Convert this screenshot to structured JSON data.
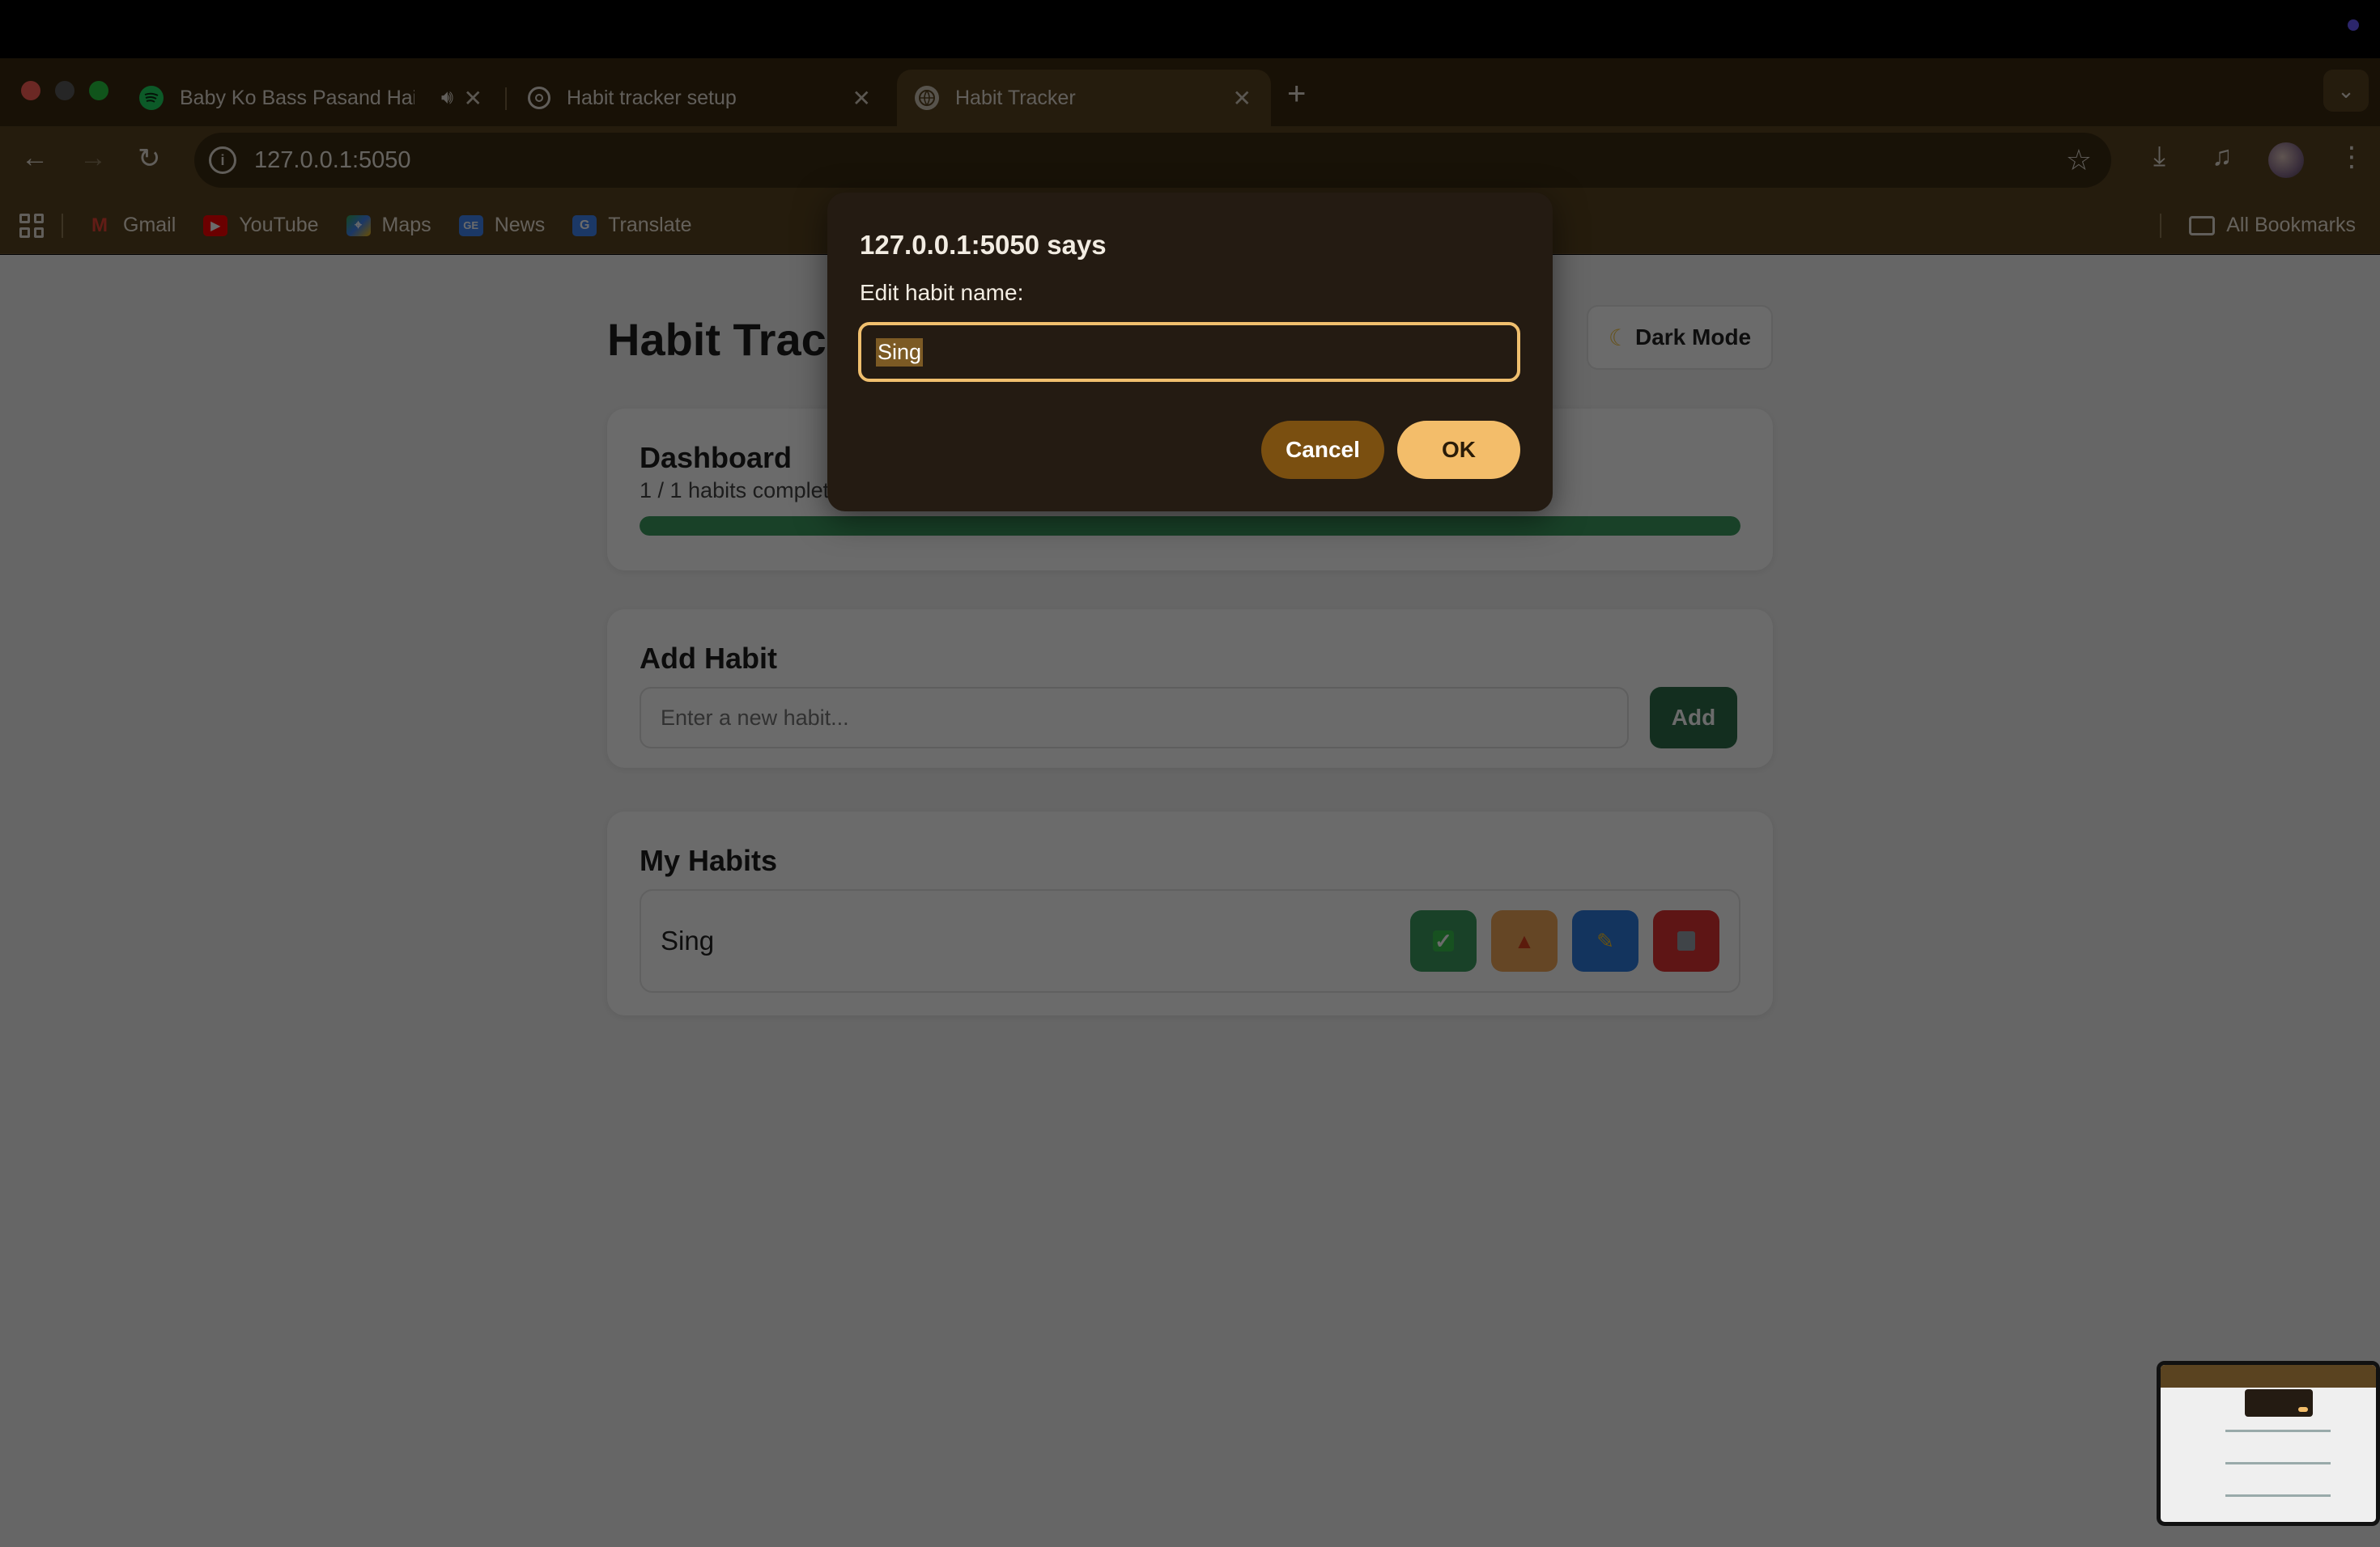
{
  "browser": {
    "tabs": [
      {
        "title": "Baby Ko Bass Pasand Hai",
        "favicon": "spotify-icon",
        "audio": true
      },
      {
        "title": "Habit tracker setup",
        "favicon": "openai-icon"
      },
      {
        "title": "Habit Tracker",
        "favicon": "globe-icon",
        "active": true
      }
    ],
    "url": "127.0.0.1:5050",
    "bookmarks": [
      {
        "label": "Gmail",
        "icon": "gmail-icon",
        "color": "#ea4335"
      },
      {
        "label": "YouTube",
        "icon": "youtube-icon",
        "color": "#ff0000"
      },
      {
        "label": "Maps",
        "icon": "maps-icon",
        "color": "#34a853"
      },
      {
        "label": "News",
        "icon": "news-icon",
        "color": "#4285f4"
      },
      {
        "label": "Translate",
        "icon": "translate-icon",
        "color": "#4285f4"
      }
    ],
    "all_bookmarks": "All Bookmarks"
  },
  "app": {
    "title": "Habit Tracker",
    "dark_mode_label": "Dark Mode",
    "dashboard": {
      "heading": "Dashboard",
      "progress_text": "1 / 1 habits completed",
      "progress_fraction": 1.0,
      "progress_color": "#3d9b5f"
    },
    "add_habit": {
      "heading": "Add Habit",
      "placeholder": "Enter a new habit...",
      "button_label": "Add"
    },
    "my_habits": {
      "heading": "My Habits",
      "items": [
        {
          "name": "Sing",
          "actions": [
            "check-icon",
            "fire-icon",
            "pencil-icon",
            "trash-icon"
          ]
        }
      ]
    }
  },
  "dialog": {
    "title": "127.0.0.1:5050 says",
    "message": "Edit habit name:",
    "value": "Sing",
    "cancel_label": "Cancel",
    "ok_label": "OK"
  }
}
